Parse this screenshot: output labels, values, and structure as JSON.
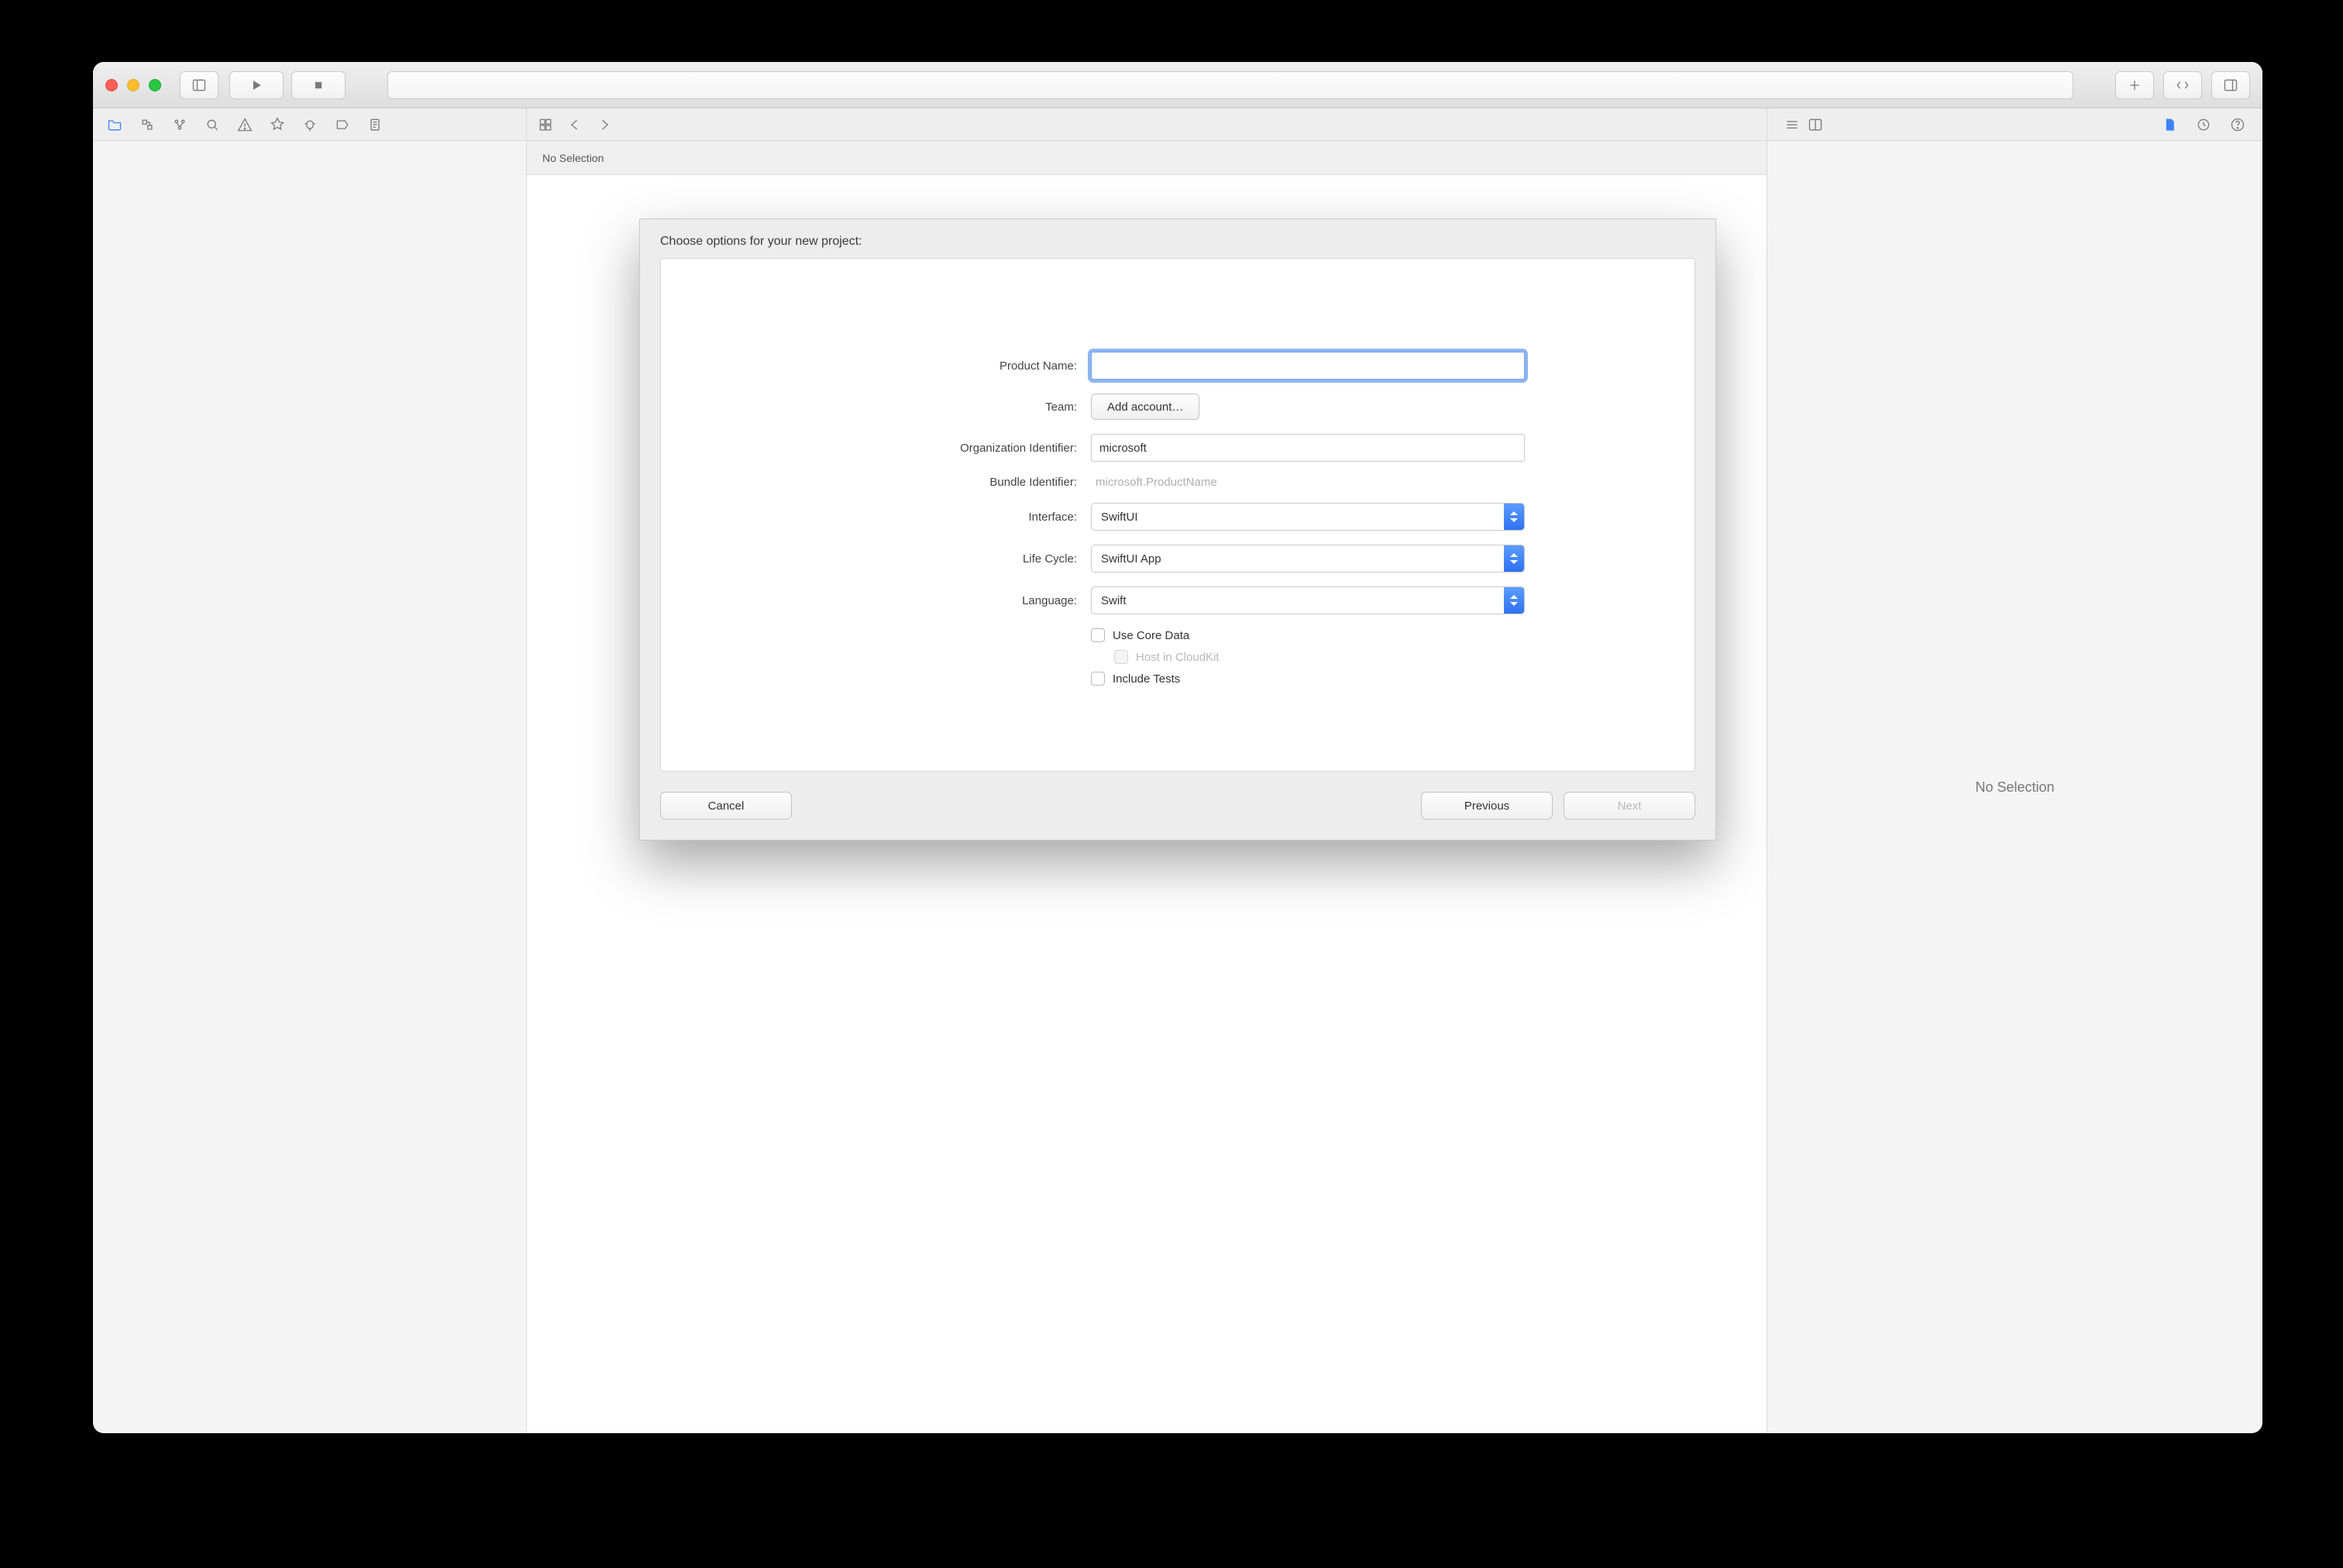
{
  "editor": {
    "jumpbar": "No Selection"
  },
  "inspector": {
    "placeholder": "No Selection"
  },
  "dialog": {
    "title": "Choose options for your new project:",
    "fields": {
      "product_name": {
        "label": "Product Name:",
        "value": ""
      },
      "team": {
        "label": "Team:",
        "button": "Add account…"
      },
      "org_id": {
        "label": "Organization Identifier:",
        "value": "microsoft"
      },
      "bundle_id": {
        "label": "Bundle Identifier:",
        "value": "microsoft.ProductName"
      },
      "interface": {
        "label": "Interface:",
        "value": "SwiftUI"
      },
      "life_cycle": {
        "label": "Life Cycle:",
        "value": "SwiftUI App"
      },
      "language": {
        "label": "Language:",
        "value": "Swift"
      },
      "core_data": {
        "label": "Use Core Data"
      },
      "cloudkit": {
        "label": "Host in CloudKit"
      },
      "tests": {
        "label": "Include Tests"
      }
    },
    "buttons": {
      "cancel": "Cancel",
      "previous": "Previous",
      "next": "Next"
    }
  }
}
